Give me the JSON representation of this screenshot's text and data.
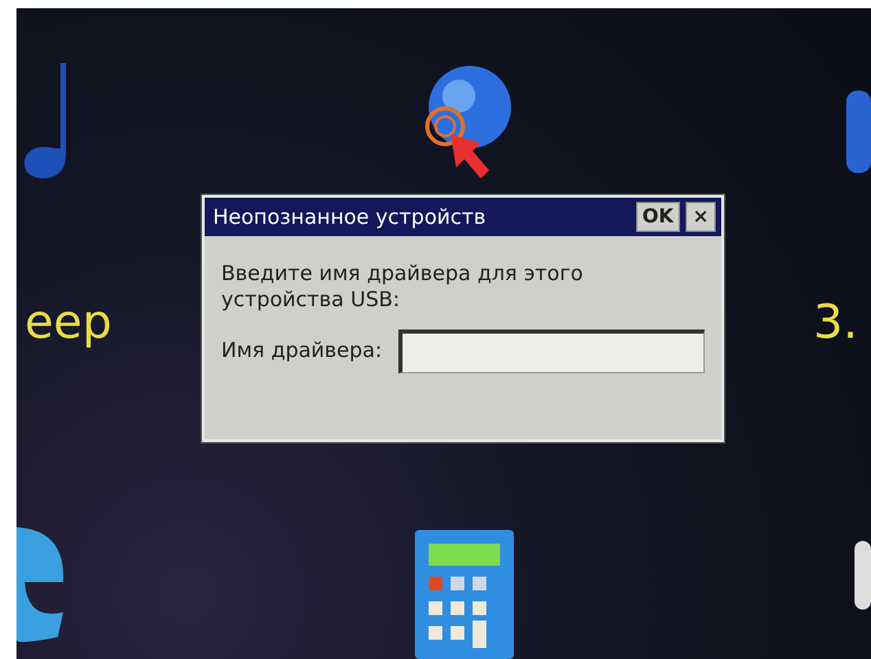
{
  "desktop": {
    "left_label": "еер",
    "right_label": "3."
  },
  "dialog": {
    "title": "Неопознанное устройств",
    "ok_button": "OK",
    "close_button": "×",
    "message": "Введите имя драйвера для этого устройства USB:",
    "field_label": "Имя драйвера:"
  }
}
